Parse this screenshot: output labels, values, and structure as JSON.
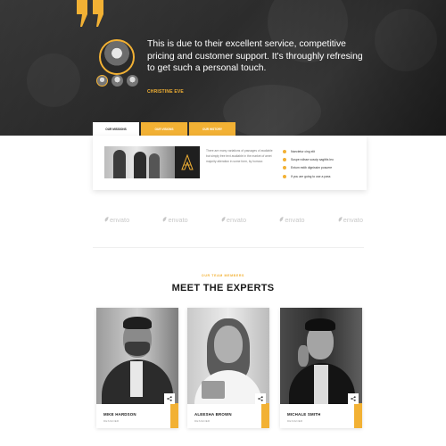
{
  "testimonial": {
    "quote": "This is due to their excellent service, competitive pricing and customer support. It's throughly refresing to get such a personal touch.",
    "author": "CHRISTINE EVE"
  },
  "tabs": [
    {
      "label": "OUR MISSIONS",
      "active": true
    },
    {
      "label": "OUR VISIONS",
      "active": false
    },
    {
      "label": "OUR HISTORY",
      "active": false
    }
  ],
  "panel": {
    "text": "There are many variations of passages of available but simply free text available in the market of amet majority alteration in some form, by humour.",
    "checklist": [
      "Nsectetur cing elit",
      "Suspe ndisse suscip sagittis leo",
      "Entum estib dignissim posuere",
      "If you are going to use a pass"
    ]
  },
  "partners": [
    "envato",
    "envato",
    "envato",
    "envato",
    "envato"
  ],
  "team": {
    "eyebrow": "OUR TEAM MEMBERS",
    "title": "MEET THE EXPERTS",
    "members": [
      {
        "name": "MIKE HARDSON",
        "role": "DESIGNER"
      },
      {
        "name": "ALEESHA BROWN",
        "role": "DESIGNER"
      },
      {
        "name": "MICHALE SMITH",
        "role": "DESIGNER"
      }
    ]
  },
  "colors": {
    "accent": "#f2b134",
    "dark": "#2f2f2f"
  },
  "icons": [
    "quote-icon",
    "share-icon",
    "envato-leaf-icon",
    "check-icon"
  ]
}
